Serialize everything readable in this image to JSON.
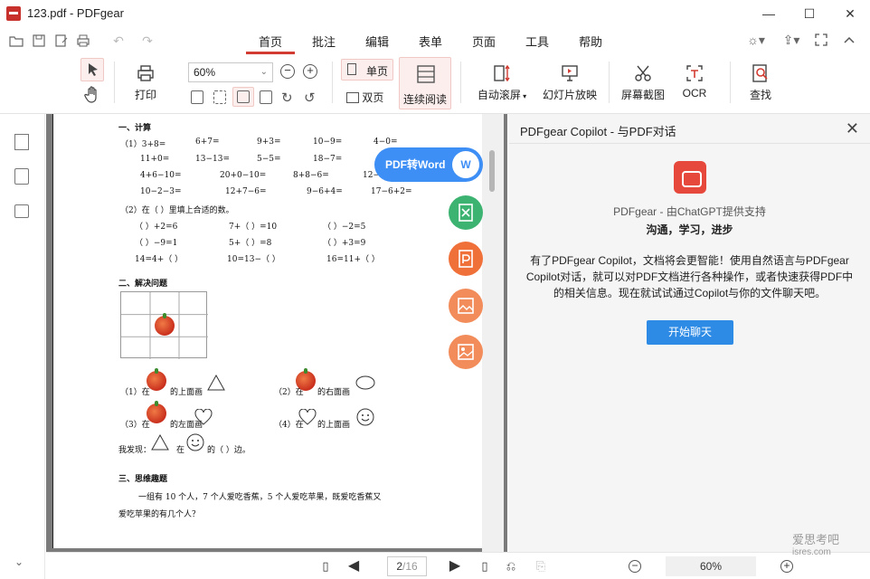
{
  "window": {
    "title": "123.pdf - PDFgear",
    "minimize": "—",
    "maximize": "☐",
    "close": "✕"
  },
  "quick_access": [
    {
      "name": "open-icon",
      "glyph": "📂"
    },
    {
      "name": "save-icon",
      "glyph": "💾"
    },
    {
      "name": "save-as-icon",
      "glyph": "🗎"
    },
    {
      "name": "print-icon",
      "glyph": "🖶"
    },
    {
      "name": "undo-icon",
      "glyph": "↶"
    },
    {
      "name": "redo-icon",
      "glyph": "↷"
    }
  ],
  "tabs": [
    {
      "label": "首页",
      "active": true
    },
    {
      "label": "批注"
    },
    {
      "label": "编辑"
    },
    {
      "label": "表单"
    },
    {
      "label": "页面"
    },
    {
      "label": "工具"
    },
    {
      "label": "帮助"
    }
  ],
  "ribbon": {
    "print": "打印",
    "zoom_value": "60%",
    "single_page": "单页",
    "double_page": "双页",
    "continuous": "连续阅读",
    "auto_scroll": "自动滚屏",
    "slideshow": "幻灯片放映",
    "screenshot": "屏幕截图",
    "ocr": "OCR",
    "find": "查找"
  },
  "document": {
    "lines": [
      "一、计算",
      "（1）3+8=",
      "6+7=",
      "9+3=",
      "10−9=",
      "4−0=",
      "11+0=",
      "13−13=",
      "5−5=",
      "18−7=",
      "4+6−10=",
      "20+0−10=",
      "8+8−6=",
      "12−",
      "10−2−3=",
      "12+7−6=",
      "9−6+4=",
      "17−6+2=",
      "（2）在（  ）里填上合适的数。",
      "（      ）+2=6",
      "7+（    ）=10",
      "（      ）−2=5",
      "（      ）−9=1",
      "5+（    ）=8",
      "（      ）+3=9",
      "14=4+（      ）",
      "10=13−（      ）",
      "16=11+（      ）",
      "二、解决问题",
      "（1）在",
      "的上面画",
      "（2）在",
      "的右面画",
      "（3）在",
      "的左面画",
      "（4）在",
      "的上面画",
      "我发现：",
      "在",
      "的（        ）边。",
      "三、思维趣题",
      "一组有 10 个人，7 个人爱吃香蕉，5 个人爱吃苹果，既爱吃香蕉又",
      "爱吃苹果的有几个人？"
    ],
    "float_word_label": "PDF转Word",
    "float_word_badge": "W"
  },
  "copilot": {
    "title": "PDFgear Copilot - 与PDF对话",
    "subtitle": "PDFgear - 由ChatGPT提供支持",
    "tagline": "沟通，学习，进步",
    "description": "有了PDFgear Copilot，文档将会更智能！使用自然语言与PDFgear Copilot对话，就可以对PDF文档进行各种操作，或者快速获得PDF中的相关信息。现在就试试通过Copilot与你的文件聊天吧。",
    "start_button": "开始聊天"
  },
  "status": {
    "current_page": "2",
    "total_pages": "/16",
    "zoom": "60%"
  },
  "watermark": {
    "line1": "爱思考吧",
    "line2": "isres.com"
  },
  "colors": {
    "accent_red": "#d23b32",
    "copilot_button": "#2d8be6",
    "word_button": "#3d8ef5",
    "excel_green": "#3cb371",
    "orange": "#f0703a"
  }
}
